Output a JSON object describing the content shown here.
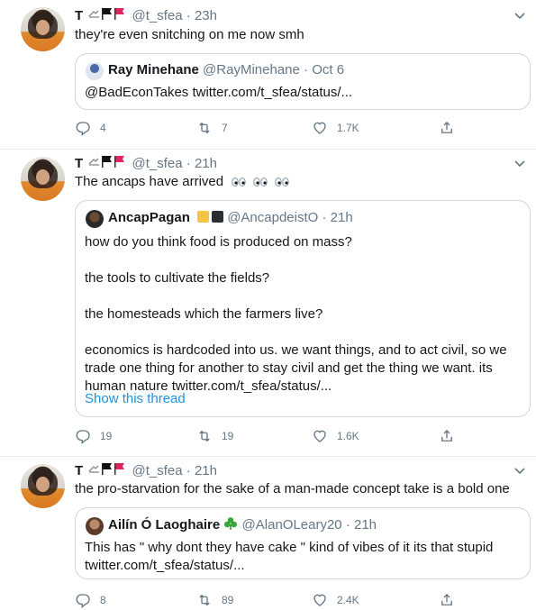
{
  "author": {
    "name": "T",
    "handle": "@t_sfea"
  },
  "tweets": [
    {
      "time": "23h",
      "text": "they're even snitching on me now smh",
      "quote": {
        "name": "Ray Minehane",
        "handle": "@RayMinehane",
        "dot": "·",
        "time": "Oct 6",
        "body": "@BadEconTakes twitter.com/t_sfea/status/..."
      },
      "actions": {
        "reply": "4",
        "retweet": "7",
        "like": "1.7K"
      }
    },
    {
      "time": "21h",
      "text": "The ancaps have arrived",
      "quote": {
        "name": "AncapPagan",
        "handle": "@AncapdeistO",
        "dot": "·",
        "time": "21h",
        "body": "how do you think food is produced on mass?\n\nthe tools to cultivate the fields?\n\nthe homesteads which the farmers live?\n\neconomics is hardcoded into us. we want things, and to act civil, so we trade one thing for another to stay civil and get the thing we want. its human nature twitter.com/t_sfea/status/...",
        "show_thread": "Show this thread"
      },
      "actions": {
        "reply": "19",
        "retweet": "19",
        "like": "1.6K"
      }
    },
    {
      "time": "21h",
      "text": "the pro-starvation for the sake of a man-made concept take is a bold one",
      "quote": {
        "name": "Ailín Ó Laoghaire",
        "handle": "@AlanOLeary20",
        "dot": "·",
        "time": "21h",
        "body": "This has \" why dont they have cake \" kind of vibes of it its that stupid twitter.com/t_sfea/status/..."
      },
      "actions": {
        "reply": "8",
        "retweet": "89",
        "like": "2.4K"
      }
    }
  ],
  "separator": "·",
  "colors": {
    "accent": "#1b95e0",
    "muted": "#657786",
    "border": "#ccd6dd",
    "avatar_shirt": "#d97a23"
  },
  "icons": [
    "reply-icon",
    "retweet-icon",
    "like-icon",
    "share-icon",
    "chevron-down-icon",
    "flag-icon",
    "shamrock-icon"
  ]
}
